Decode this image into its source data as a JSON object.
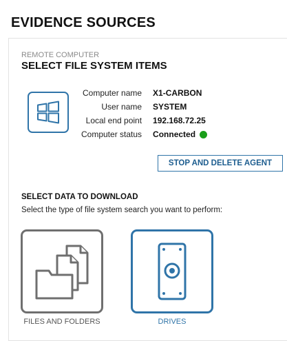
{
  "page": {
    "title": "EVIDENCE SOURCES"
  },
  "remote": {
    "eyebrow": "REMOTE COMPUTER",
    "title": "SELECT FILE SYSTEM ITEMS",
    "os_icon": "windows-logo-icon",
    "info": {
      "computer_name_label": "Computer name",
      "computer_name_value": "X1-CARBON",
      "user_name_label": "User name",
      "user_name_value": "SYSTEM",
      "endpoint_label": "Local end point",
      "endpoint_value": "192.168.72.25",
      "status_label": "Computer status",
      "status_value": "Connected",
      "status_color": "#1a9e1a"
    },
    "stop_button_label": "STOP AND DELETE AGENT"
  },
  "download": {
    "title": "SELECT DATA TO DOWNLOAD",
    "description": "Select the type of file system search you want to perform:",
    "options": [
      {
        "label": "FILES AND FOLDERS",
        "icon": "files-folders-icon",
        "selected": false
      },
      {
        "label": "DRIVES",
        "icon": "drive-icon",
        "selected": true
      }
    ]
  },
  "colors": {
    "accent": "#2f74a8",
    "unselected_border": "#6f6f6f",
    "icon_gray": "#6f6f6f",
    "panel_border": "#e2e2e2"
  }
}
